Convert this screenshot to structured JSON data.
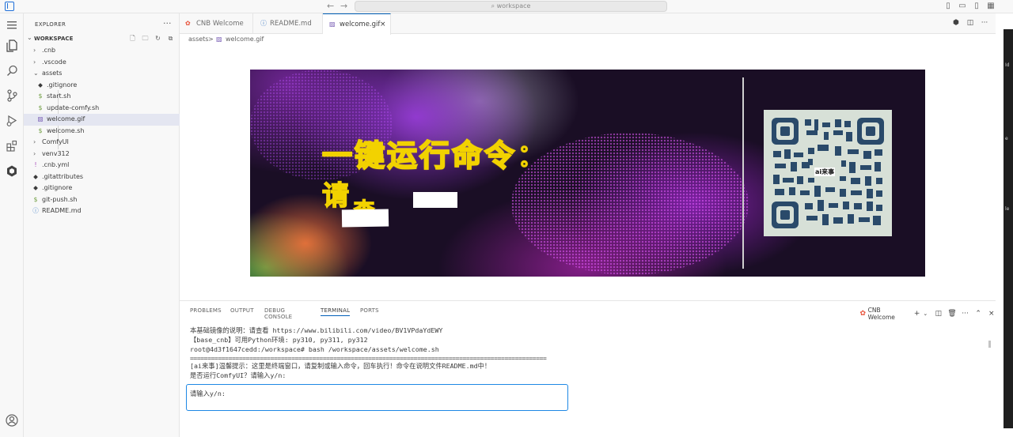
{
  "titlebar": {
    "search_text": "workspace"
  },
  "sidebar": {
    "title": "EXPLORER",
    "workspace_label": "WORKSPACE",
    "items": [
      {
        "label": ".cnb",
        "type": "folder",
        "open": false,
        "depth": 0
      },
      {
        "label": ".vscode",
        "type": "folder",
        "open": false,
        "depth": 0
      },
      {
        "label": "assets",
        "type": "folder",
        "open": true,
        "depth": 0
      },
      {
        "label": ".gitignore",
        "type": "git",
        "depth": 1
      },
      {
        "label": "start.sh",
        "type": "shell",
        "depth": 1
      },
      {
        "label": "update-comfy.sh",
        "type": "shell",
        "depth": 1
      },
      {
        "label": "welcome.gif",
        "type": "image",
        "depth": 1,
        "selected": true
      },
      {
        "label": "welcome.sh",
        "type": "shell",
        "depth": 1
      },
      {
        "label": "ComfyUI",
        "type": "folder",
        "open": false,
        "depth": 0
      },
      {
        "label": "venv312",
        "type": "folder",
        "open": false,
        "depth": 0
      },
      {
        "label": ".cnb.yml",
        "type": "yaml",
        "depth": 0
      },
      {
        "label": ".gitattributes",
        "type": "git",
        "depth": 0
      },
      {
        "label": ".gitignore",
        "type": "git",
        "depth": 0
      },
      {
        "label": "git-push.sh",
        "type": "shell",
        "depth": 0
      },
      {
        "label": "README.md",
        "type": "info",
        "depth": 0
      }
    ]
  },
  "tabs": [
    {
      "label": "CNB Welcome",
      "icon": "cnb-icon",
      "active": false
    },
    {
      "label": "README.md",
      "icon": "info-icon",
      "active": false
    },
    {
      "label": "welcome.gif",
      "icon": "image-icon",
      "active": true,
      "close": "×"
    }
  ],
  "breadcrumb": {
    "folder": "assets",
    "sep": ">",
    "file": "welcome.gif"
  },
  "banner": {
    "title": "一键运行命令：",
    "line2_char1": "请",
    "line2_char2": "查",
    "qr_label": "ai来事"
  },
  "panel": {
    "tabs": [
      {
        "label": "PROBLEMS",
        "active": false
      },
      {
        "label": "OUTPUT",
        "active": false
      },
      {
        "label": "DEBUG CONSOLE",
        "active": false
      },
      {
        "label": "TERMINAL",
        "active": true
      },
      {
        "label": "PORTS",
        "active": false
      }
    ],
    "terminal_name": "CNB Welcome",
    "terminal_lines": [
      "本基础镜像的说明：请查看 https://www.bilibili.com/video/BV1VPdaYdEWY",
      "【base_cnb】可用Python环境: py310, py311, py312",
      "root@4d3f1647cedd:/workspace# bash /workspace/assets/welcome.sh"
    ],
    "separator": "======================================================================================================",
    "notice_lines": [
      "[ai来事]温馨提示：这里是终端窗口，请复制或输入命令，回车执行！命令在说明文件README.md中！",
      "是否运行ComfyUI？请输入y/n:"
    ],
    "input_prompt": "请输入y/n:"
  },
  "right_strip": {
    "labels": [
      "Id",
      "e",
      "le"
    ]
  },
  "colors": {
    "accent": "#005fb8",
    "input_border": "#1e88e5",
    "banner_text_stroke": "#f2d200",
    "selected_bg": "#e4e6f1"
  }
}
